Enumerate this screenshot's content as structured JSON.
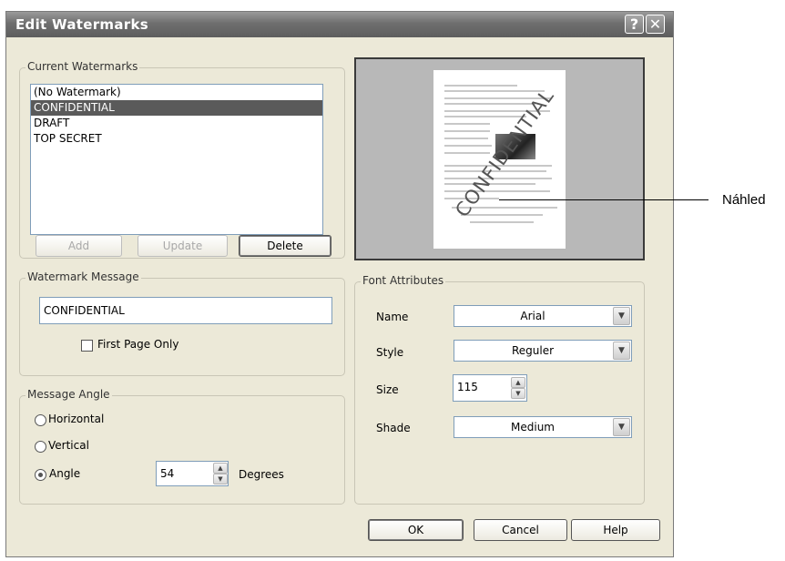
{
  "dialog": {
    "title": "Edit Watermarks",
    "help_glyph": "?",
    "close_glyph": "✕"
  },
  "current_watermarks": {
    "label": "Current Watermarks",
    "items": [
      "(No Watermark)",
      "CONFIDENTIAL",
      "DRAFT",
      "TOP SECRET"
    ],
    "selected_index": 1,
    "add_label": "Add",
    "update_label": "Update",
    "delete_label": "Delete"
  },
  "watermark_message": {
    "label": "Watermark Message",
    "value": "CONFIDENTIAL",
    "first_page_only_label": "First Page Only",
    "first_page_only_checked": false
  },
  "message_angle": {
    "label": "Message Angle",
    "horizontal_label": "Horizontal",
    "vertical_label": "Vertical",
    "angle_label": "Angle",
    "selected": "Angle",
    "angle_value": "54",
    "degrees_label": "Degrees"
  },
  "preview": {
    "watermark_text": "CONFIDENTIAL",
    "callout_label": "Náhled"
  },
  "font_attributes": {
    "label": "Font Attributes",
    "name_label": "Name",
    "name_value": "Arial",
    "style_label": "Style",
    "style_value": "Reguler",
    "size_label": "Size",
    "size_value": "115",
    "shade_label": "Shade",
    "shade_value": "Medium"
  },
  "footer": {
    "ok_label": "OK",
    "cancel_label": "Cancel",
    "help_label": "Help"
  },
  "icons": {
    "dropdown": "chevron-down-icon",
    "spin_up": "spin-up-icon",
    "spin_down": "spin-down-icon"
  }
}
